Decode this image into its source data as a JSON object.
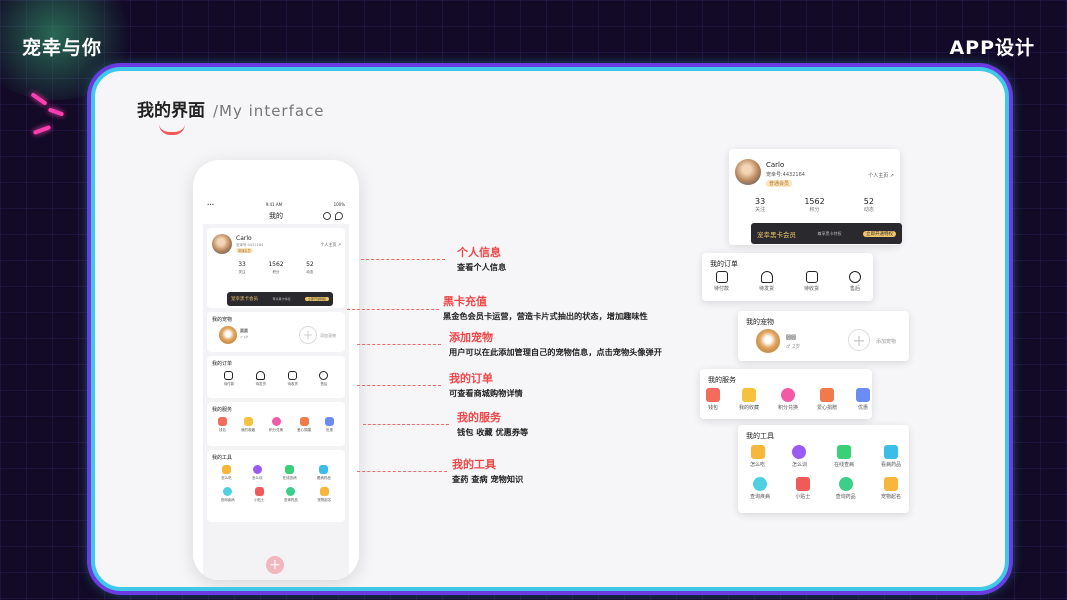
{
  "brand": "宠幸与你",
  "tagline": "APP设计",
  "header": {
    "title": "我的界面",
    "subtitle": "/My interface"
  },
  "phone": {
    "status": {
      "time": "9:41 AM",
      "battery": "100%"
    },
    "nav_title": "我的",
    "profile": {
      "name": "Carlo",
      "id": "宠幸号:4432164",
      "badge": "普通会员",
      "home_link": "个人主页 ↗",
      "stats": [
        {
          "value": "33",
          "label": "关注"
        },
        {
          "value": "1562",
          "label": "积分"
        },
        {
          "value": "52",
          "label": "动态"
        }
      ]
    },
    "vip": {
      "title": "宠幸黑卡会员",
      "hint": "尊享黑卡特权",
      "button": "立即开通特权"
    },
    "pets": {
      "title": "我的宠物",
      "pet_name": "圆圆",
      "pet_tag": "♂ 2岁",
      "add_label": "添加宠物"
    },
    "orders": {
      "title": "我的订单",
      "items": [
        "待付款",
        "待发货",
        "待收货",
        "售后"
      ]
    },
    "services": {
      "title": "我的服务",
      "items": [
        "钱包",
        "我的收藏",
        "积分兑换",
        "爱心捐赠",
        "优惠"
      ]
    },
    "tools": {
      "title": "我的工具",
      "items": [
        "怎么吃",
        "怎么训",
        "在线查病",
        "看病药品",
        "查询疾病",
        "小贴士",
        "查询药品",
        "宠物起名"
      ]
    }
  },
  "annotations": [
    {
      "title": "个人信息",
      "desc": "查看个人信息"
    },
    {
      "title": "黑卡充值",
      "desc": "黑金色会员卡运营，营造卡片式抽出的状态，增加趣味性"
    },
    {
      "title": "添加宠物",
      "desc": "用户可以在此添加管理自己的宠物信息，点击宠物头像弹开"
    },
    {
      "title": "我的订单",
      "desc": "可查看商城购物详情"
    },
    {
      "title": "我的服务",
      "desc": "钱包  收藏  优惠券等"
    },
    {
      "title": "我的工具",
      "desc": "查药  查病  宠物知识"
    }
  ],
  "colors": {
    "accent": "#f0474a",
    "frame": "#3fc9e8",
    "frame_outer": "#6a3be0",
    "gold": "#f1c56a",
    "dark_card": "#2a2a2e"
  }
}
